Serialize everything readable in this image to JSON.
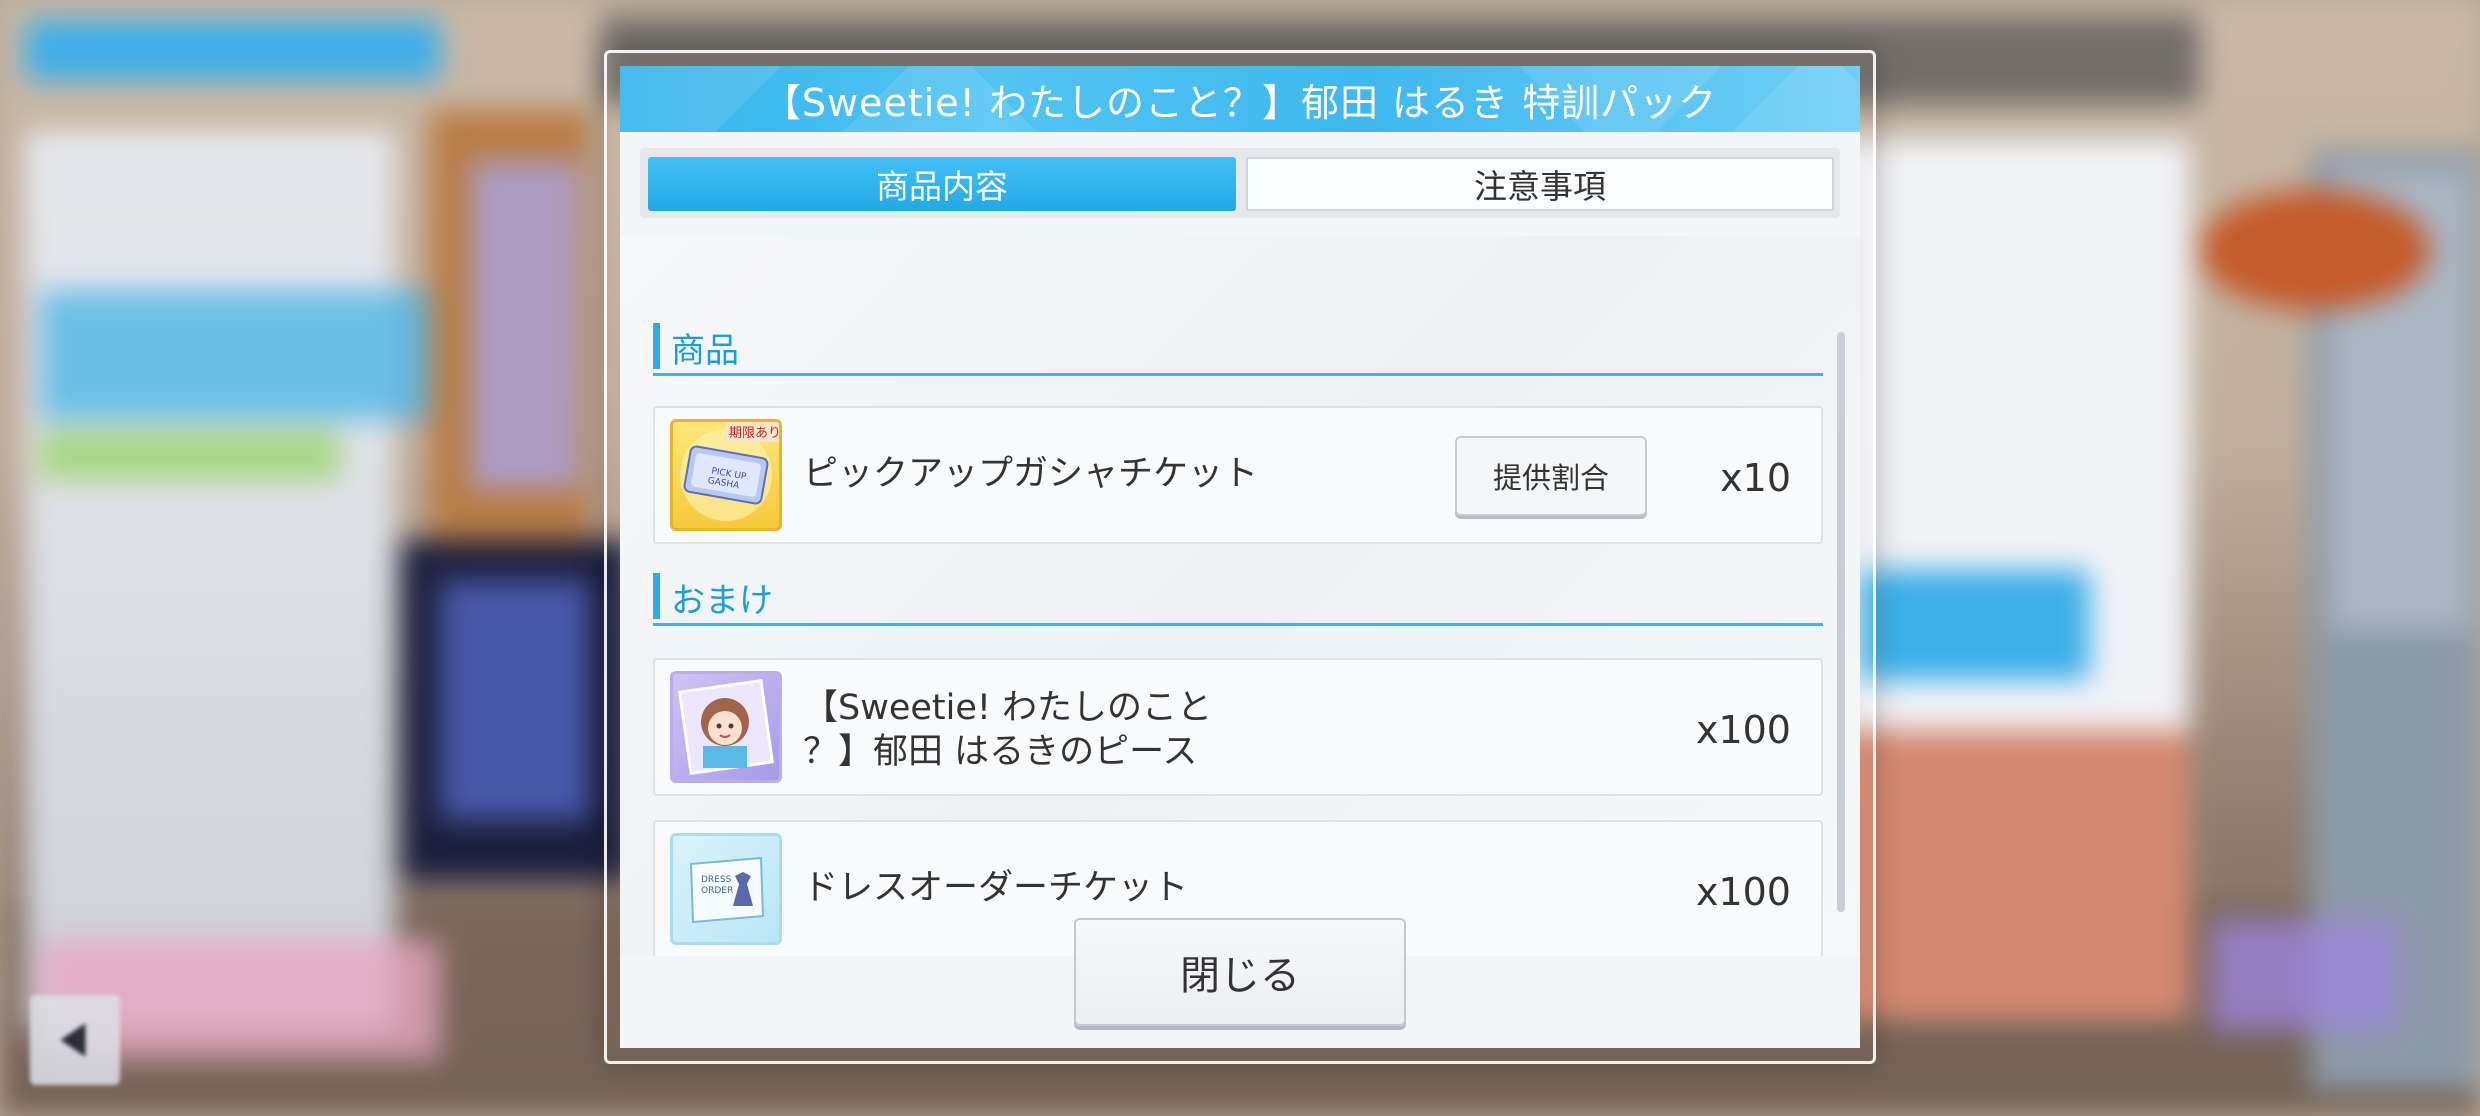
{
  "dialog": {
    "title": "【Sweetie! わたしのこと？】郁田 はるき 特訓パック",
    "tabs": [
      {
        "label": "商品内容",
        "active": true
      },
      {
        "label": "注意事項",
        "active": false
      }
    ]
  },
  "sections": {
    "products": {
      "heading": "商品",
      "items": [
        {
          "icon": "gasha-ticket-icon",
          "badge": "期限あり",
          "icon_text": "PICK UP GASHA TICKET",
          "name": "ピックアップガシャチケット",
          "rate_button": "提供割合",
          "quantity": "x10"
        }
      ]
    },
    "bonus": {
      "heading": "おまけ",
      "items": [
        {
          "icon": "character-piece-icon",
          "name_line1": "【Sweetie! わたしのこと",
          "name_line2": "？】郁田 はるきのピース",
          "quantity": "x100"
        },
        {
          "icon": "dress-order-ticket-icon",
          "icon_text": "DRESS ORDER",
          "name": "ドレスオーダーチケット",
          "quantity": "x100"
        }
      ]
    }
  },
  "footer": {
    "close_label": "閉じる"
  },
  "colors": {
    "accent": "#2eace8",
    "header": "#3fb8ef"
  }
}
